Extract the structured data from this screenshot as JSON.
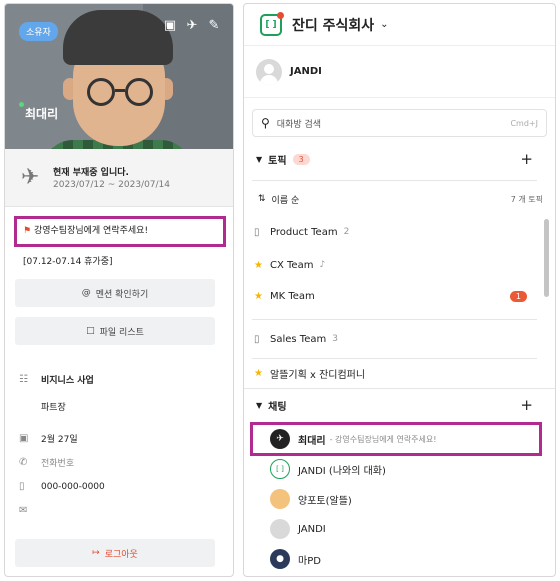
{
  "profile": {
    "badge": "소유자",
    "name": "최대리",
    "away_title": "현재 부재중 입니다.",
    "away_dates": "2023/07/12 ~ 2023/07/14",
    "status_message": "강영수팀장님에게 연락주세요!",
    "vacation_note": "[07.12-07.14 휴가중]",
    "mention_button": "멘션 확인하기",
    "file_button": "파일 리스트",
    "department": "비지니스 사업",
    "position": "파트장",
    "birthday": "2월 27일",
    "phone_placeholder": "전화번호",
    "phone": "000-000-0000",
    "logout": "로그아웃"
  },
  "sidebar": {
    "company": "잔디 주식회사",
    "user": "JANDI",
    "search_placeholder": "대화방 검색",
    "search_shortcut": "Cmd+J",
    "topic_label": "토픽",
    "topic_count": "3",
    "sort_label": "이름 순",
    "topic_total": "7 개 토픽",
    "topics": [
      {
        "name": "Product Team",
        "num": "2",
        "icon": "folder-icon"
      },
      {
        "name": "CX Team",
        "num": "",
        "icon": "star-icon"
      },
      {
        "name": "MK Team",
        "num": "",
        "icon": "star-icon",
        "unread": "1"
      },
      {
        "name": "Sales Team",
        "num": "3",
        "icon": "folder-icon"
      },
      {
        "name": "알뜰기획 x 잔디컴퍼니",
        "num": "",
        "icon": "star-icon"
      }
    ],
    "chat_label": "채팅",
    "chats": [
      {
        "name": "최대리",
        "status": "- 강영수팀장님에게 연락주세요!"
      },
      {
        "name": "JANDI (나와의 대화)",
        "status": ""
      },
      {
        "name": "양포토(알뜰)",
        "status": ""
      },
      {
        "name": "JANDI",
        "status": ""
      },
      {
        "name": "마PD",
        "status": ""
      }
    ]
  }
}
